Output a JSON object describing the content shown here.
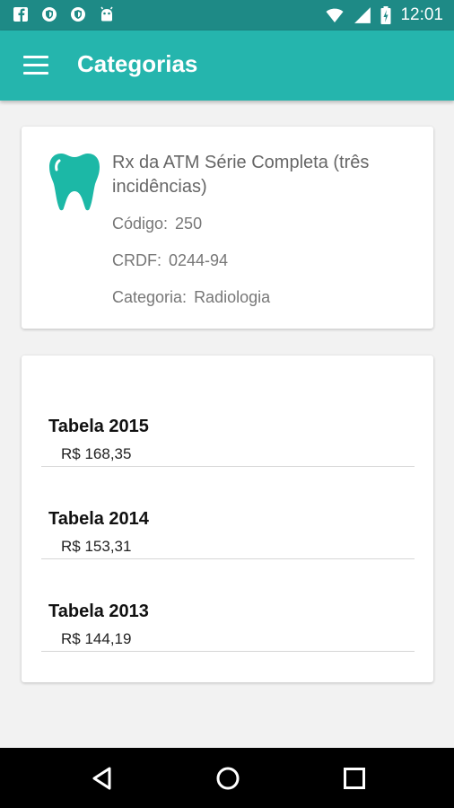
{
  "status_bar": {
    "time": "12:01",
    "left_icons": [
      "facebook-icon",
      "shield-icon",
      "shield-icon",
      "android-icon"
    ],
    "right_icons": [
      "vibrate-icon",
      "wifi-icon",
      "signal-icon",
      "battery-icon"
    ]
  },
  "app_bar": {
    "title": "Categorias",
    "menu_icon": "hamburger-menu-icon",
    "color": "#25b5ad"
  },
  "info_card": {
    "icon": "tooth-icon",
    "icon_color": "#1cb8a6",
    "title": "Rx da ATM Série Completa (três incidências)",
    "code_label": "Código:",
    "code_value": "250",
    "crdf_label": "CRDF:",
    "crdf_value": "0244-94",
    "category_label": "Categoria:",
    "category_value": "Radiologia"
  },
  "prices": [
    {
      "label": "Tabela 2015",
      "value": "R$ 168,35"
    },
    {
      "label": "Tabela 2014",
      "value": "R$ 153,31"
    },
    {
      "label": "Tabela 2013",
      "value": "R$ 144,19"
    }
  ],
  "nav_bar": {
    "buttons": [
      "back-icon",
      "home-icon",
      "recents-icon"
    ]
  }
}
